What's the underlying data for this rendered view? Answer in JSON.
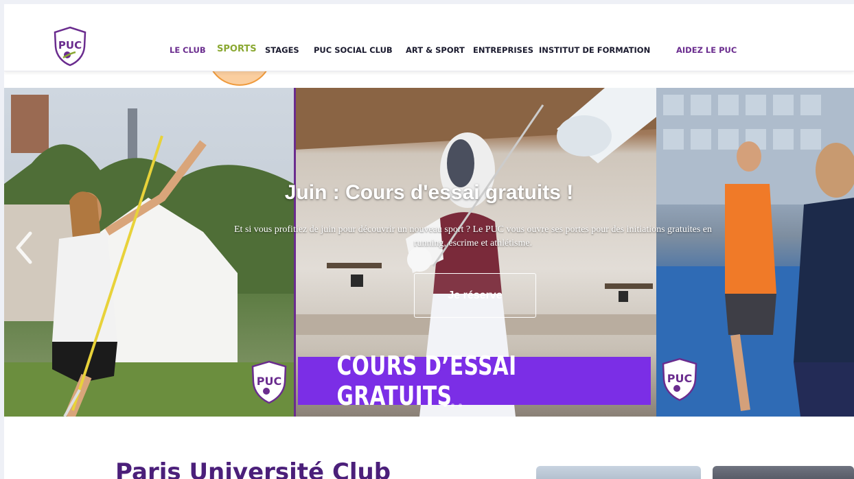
{
  "header": {
    "logo_text": "PUC",
    "nav": [
      {
        "label": "LE CLUB"
      },
      {
        "label": "SPORTS"
      },
      {
        "label": "STAGES"
      },
      {
        "label": "PUC SOCIAL CLUB"
      },
      {
        "label": "ART & SPORT"
      },
      {
        "label": "ENTREPRISES"
      },
      {
        "label": "INSTITUT DE FORMATION"
      },
      {
        "label": "AIDEZ LE PUC"
      }
    ]
  },
  "hero": {
    "title": "Juin : Cours d'essai gratuits !",
    "description": "Et si vous profitiez de juin pour découvrir un nouveau sport ? Le PUC vous ouvre ses portes pour des initiations gratuites en running, escrime et athlétisme.",
    "button_label": "Je réserve",
    "banner_text": "COURS D’ESSAI GRATUITS",
    "badge_text": "PUC",
    "active_slide": 1,
    "slides_count": 3
  },
  "main": {
    "section_title": "Paris Université Club"
  },
  "colors": {
    "brand_purple": "#6a2c8e",
    "active_green": "#8aa832",
    "banner_purple": "#7b2ee6",
    "click_highlight": "#ef9a3c"
  },
  "icons": {
    "prev": "chevron-left-icon"
  }
}
